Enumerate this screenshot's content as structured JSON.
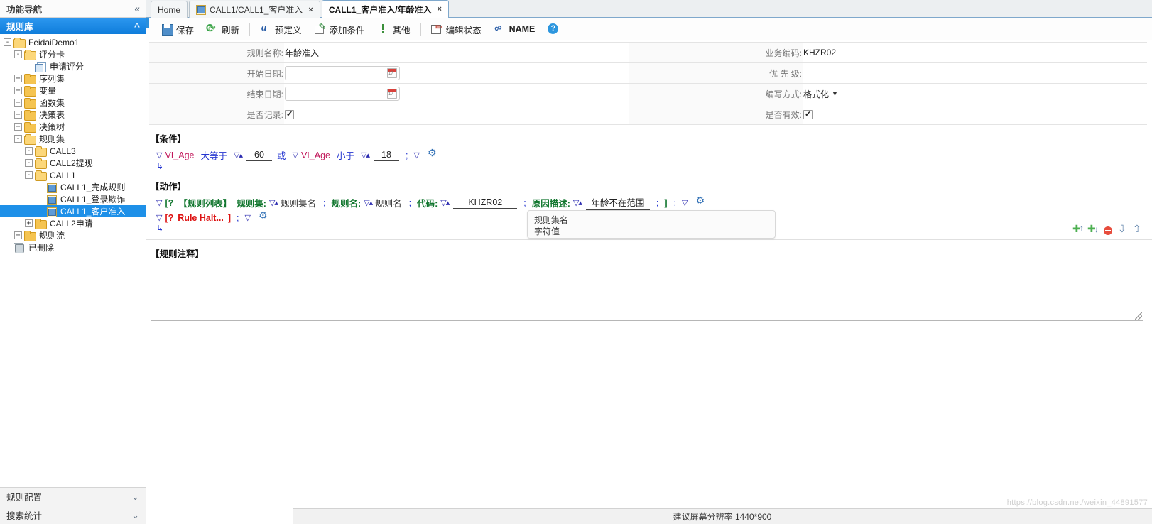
{
  "left_panel": {
    "header_title": "功能导航",
    "collapse_icon": "double-chevron-left-icon",
    "section_title": "规则库",
    "section_icon": "double-chevron-up-icon",
    "tree": [
      {
        "label": "FeidaiDemo1",
        "indent": 0,
        "twist": "-",
        "icon": "folder-open",
        "selected": false
      },
      {
        "label": "评分卡",
        "indent": 1,
        "twist": "-",
        "icon": "folder-open",
        "selected": false
      },
      {
        "label": "申请评分",
        "indent": 2,
        "twist": "",
        "icon": "doc",
        "selected": false
      },
      {
        "label": "序列集",
        "indent": 1,
        "twist": "+",
        "icon": "folder",
        "selected": false
      },
      {
        "label": "变量",
        "indent": 1,
        "twist": "+",
        "icon": "folder",
        "selected": false
      },
      {
        "label": "函数集",
        "indent": 1,
        "twist": "+",
        "icon": "folder",
        "selected": false
      },
      {
        "label": "决策表",
        "indent": 1,
        "twist": "+",
        "icon": "folder",
        "selected": false
      },
      {
        "label": "决策树",
        "indent": 1,
        "twist": "+",
        "icon": "folder",
        "selected": false
      },
      {
        "label": "规则集",
        "indent": 1,
        "twist": "-",
        "icon": "folder-open",
        "selected": false
      },
      {
        "label": "CALL3",
        "indent": 2,
        "twist": "-",
        "icon": "folder-open",
        "selected": false
      },
      {
        "label": "CALL2提现",
        "indent": 2,
        "twist": "-",
        "icon": "folder-open",
        "selected": false
      },
      {
        "label": "CALL1",
        "indent": 2,
        "twist": "-",
        "icon": "folder-open",
        "selected": false
      },
      {
        "label": "CALL1_完成规则",
        "indent": 3,
        "twist": "",
        "icon": "ruledoc",
        "selected": false
      },
      {
        "label": "CALL1_登录欺诈",
        "indent": 3,
        "twist": "",
        "icon": "ruledoc",
        "selected": false
      },
      {
        "label": "CALL1_客户准入",
        "indent": 3,
        "twist": "",
        "icon": "ruledoc",
        "selected": true
      },
      {
        "label": "CALL2申请",
        "indent": 2,
        "twist": "+",
        "icon": "folder",
        "selected": false
      },
      {
        "label": "规则流",
        "indent": 1,
        "twist": "+",
        "icon": "folder",
        "selected": false
      },
      {
        "label": "已删除",
        "indent": 0,
        "twist": "",
        "icon": "trash",
        "selected": false
      }
    ],
    "footer": [
      {
        "label": "规则配置",
        "icon": "double-chevron-down-icon"
      },
      {
        "label": "搜索统计",
        "icon": "double-chevron-down-icon"
      }
    ]
  },
  "tabs": [
    {
      "label": "Home",
      "icon": null,
      "closable": false,
      "active": false
    },
    {
      "label": "CALL1/CALL1_客户准入",
      "icon": "rule-doc-icon",
      "closable": true,
      "active": false,
      "close_label": "×"
    },
    {
      "label": "CALL1_客户准入/年龄准入",
      "icon": null,
      "closable": true,
      "active": true,
      "close_label": "×"
    }
  ],
  "toolbar": [
    {
      "label": "保存",
      "icon": "save-icon"
    },
    {
      "label": "刷新",
      "icon": "refresh-icon"
    },
    {
      "label": "预定义",
      "icon": "predefined-icon"
    },
    {
      "label": "添加条件",
      "icon": "add-condition-icon"
    },
    {
      "label": "其他",
      "icon": "other-icon"
    },
    {
      "label": "编辑状态",
      "icon": "edit-state-icon"
    },
    {
      "label": "NAME",
      "icon": "name-icon"
    },
    {
      "label": "",
      "icon": "help-icon"
    }
  ],
  "form": {
    "left": [
      {
        "label": "规则名称:",
        "type": "text",
        "value": "年龄准入"
      },
      {
        "label": "开始日期:",
        "type": "date",
        "value": ""
      },
      {
        "label": "结束日期:",
        "type": "date",
        "value": ""
      },
      {
        "label": "是否记录:",
        "type": "checkbox",
        "value": "checked"
      }
    ],
    "right": [
      {
        "label": "业务编码:",
        "type": "text",
        "value": "KHZR02"
      },
      {
        "label": "优 先 级:",
        "type": "text",
        "value": ""
      },
      {
        "label": "编写方式:",
        "type": "select",
        "value": "格式化"
      },
      {
        "label": "是否有效:",
        "type": "checkbox",
        "value": "checked"
      }
    ]
  },
  "condition": {
    "section_label": "【条件】",
    "tokens": [
      {
        "kind": "triangle",
        "text": "▽"
      },
      {
        "kind": "variable",
        "text": "VI_Age"
      },
      {
        "kind": "operator",
        "text": "大等于"
      },
      {
        "kind": "triangle2",
        "text": "▽▴"
      },
      {
        "kind": "number",
        "text": "60"
      },
      {
        "kind": "logic",
        "text": "或"
      },
      {
        "kind": "triangle",
        "text": "▽"
      },
      {
        "kind": "variable",
        "text": "VI_Age"
      },
      {
        "kind": "operator",
        "text": "小于"
      },
      {
        "kind": "triangle2",
        "text": "▽▴"
      },
      {
        "kind": "number",
        "text": "18"
      },
      {
        "kind": "semicolon",
        "text": ";"
      },
      {
        "kind": "triangle",
        "text": "▽"
      },
      {
        "kind": "gear",
        "text": "gear-icon"
      }
    ],
    "return_arrow": "↳"
  },
  "action": {
    "section_label": "【动作】",
    "row1": {
      "triangle": "▽",
      "bracket_open": "[?",
      "rule_list_label": "【规则列表】",
      "ruleset_label": "规则集:",
      "ruleset_tri": "▽▴",
      "ruleset_value": "规则集名",
      "sep1": ";",
      "rulename_label": "规则名:",
      "rulename_tri": "▽▴",
      "rulename_value": "规则名",
      "sep2": ";",
      "code_label": "代码:",
      "code_tri": "▽▴",
      "code_value": "KHZR02",
      "sep3": ";",
      "reason_label": "原因描述:",
      "reason_tri": "▽▴",
      "reason_value": "年龄不在范围",
      "sep4": ";",
      "bracket_close": "]",
      "sep5": ";",
      "tail_tri": "▽",
      "gear": "gear-icon"
    },
    "row2": {
      "triangle": "▽",
      "bracket_open": "[?",
      "label": "Rule Halt...",
      "bracket_close": "]",
      "semicolon": ";",
      "tail_tri": "▽",
      "gear": "gear-icon"
    },
    "return_arrow": "↳"
  },
  "tooltip": {
    "line1": "规则集名",
    "line2": "字符值"
  },
  "row_tools": [
    {
      "icon": "insert-row-above-icon"
    },
    {
      "icon": "insert-row-below-icon"
    },
    {
      "icon": "remove-row-icon"
    },
    {
      "icon": "move-row-down-icon"
    },
    {
      "icon": "move-row-up-icon"
    }
  ],
  "comment": {
    "section_label": "【规则注释】",
    "value": "",
    "resize_handle": "resize-grip-icon"
  },
  "status_bar": {
    "text": "建议屏幕分辨率 1440*900"
  },
  "watermark": {
    "text": "https://blog.csdn.net/weixin_44891577"
  },
  "colors": {
    "accent": "#1e90e8",
    "variable": "#c2185b",
    "operator": "#2536d0",
    "action_green": "#12772f",
    "halt_red": "#dd1111"
  }
}
